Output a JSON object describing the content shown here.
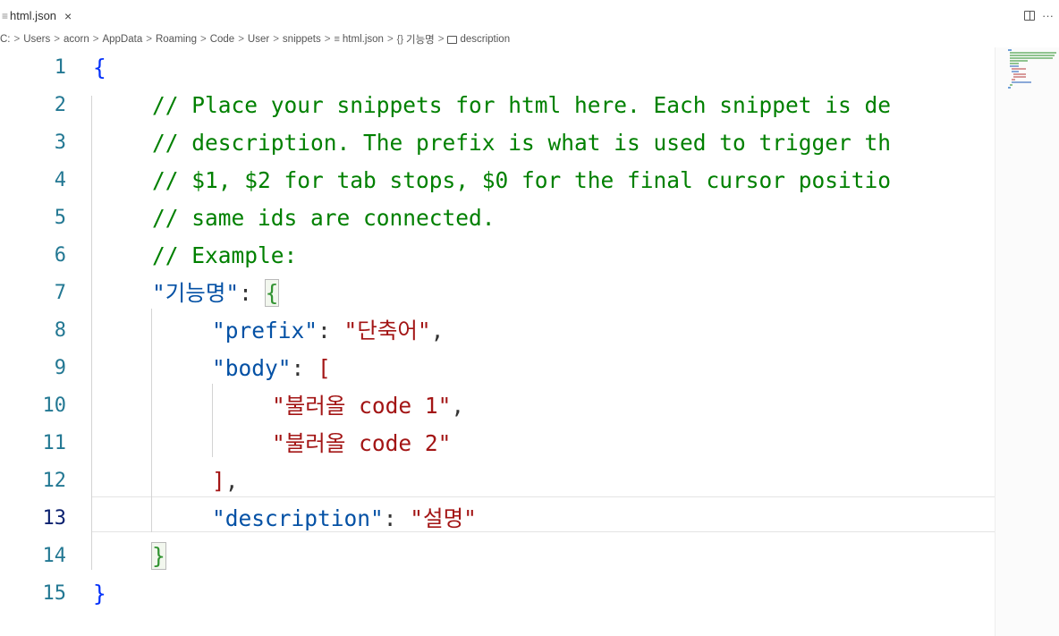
{
  "tab": {
    "icon": "≡",
    "filename": "html.json",
    "close": "×"
  },
  "actions": {
    "split_icon": "split-editor-icon",
    "more": "···"
  },
  "breadcrumb": {
    "parts": [
      "C:",
      "Users",
      "acorn",
      "AppData",
      "Roaming",
      "Code",
      "User",
      "snippets"
    ],
    "file_icon": "≡",
    "file": "html.json",
    "obj_icon": "{}",
    "obj": "기능명",
    "prop": "description"
  },
  "editor": {
    "active_line": 13,
    "line_numbers": [
      "1",
      "2",
      "3",
      "4",
      "5",
      "6",
      "7",
      "8",
      "9",
      "10",
      "11",
      "12",
      "13",
      "14",
      "15"
    ],
    "lines": {
      "l1": {
        "brace": "{"
      },
      "l2": {
        "comment": "// Place your snippets for html here. Each snippet is de"
      },
      "l3": {
        "comment": "// description. The prefix is what is used to trigger th"
      },
      "l4": {
        "comment": "// $1, $2 for tab stops, $0 for the final cursor positio"
      },
      "l5": {
        "comment": "// same ids are connected."
      },
      "l6": {
        "comment": "// Example:"
      },
      "l7": {
        "key": "\"기능명\"",
        "colon": ": ",
        "bracket": "{"
      },
      "l8": {
        "key": "\"prefix\"",
        "colon": ": ",
        "value": "\"단축어\"",
        "comma": ","
      },
      "l9": {
        "key": "\"body\"",
        "colon": ": ",
        "bracket": "["
      },
      "l10": {
        "value": "\"불러올 code 1\"",
        "comma": ","
      },
      "l11": {
        "value": "\"불러올 code 2\""
      },
      "l12": {
        "bracket": "]",
        "comma": ","
      },
      "l13": {
        "key": "\"description\"",
        "colon": ": ",
        "value": "\"설명\""
      },
      "l14": {
        "bracket": "}"
      },
      "l15": {
        "brace": "}"
      }
    }
  },
  "colors": {
    "comment": "#008000",
    "key": "#0451a5",
    "string": "#a31515",
    "line_number": "#237893",
    "active_line_number": "#0b216f"
  }
}
